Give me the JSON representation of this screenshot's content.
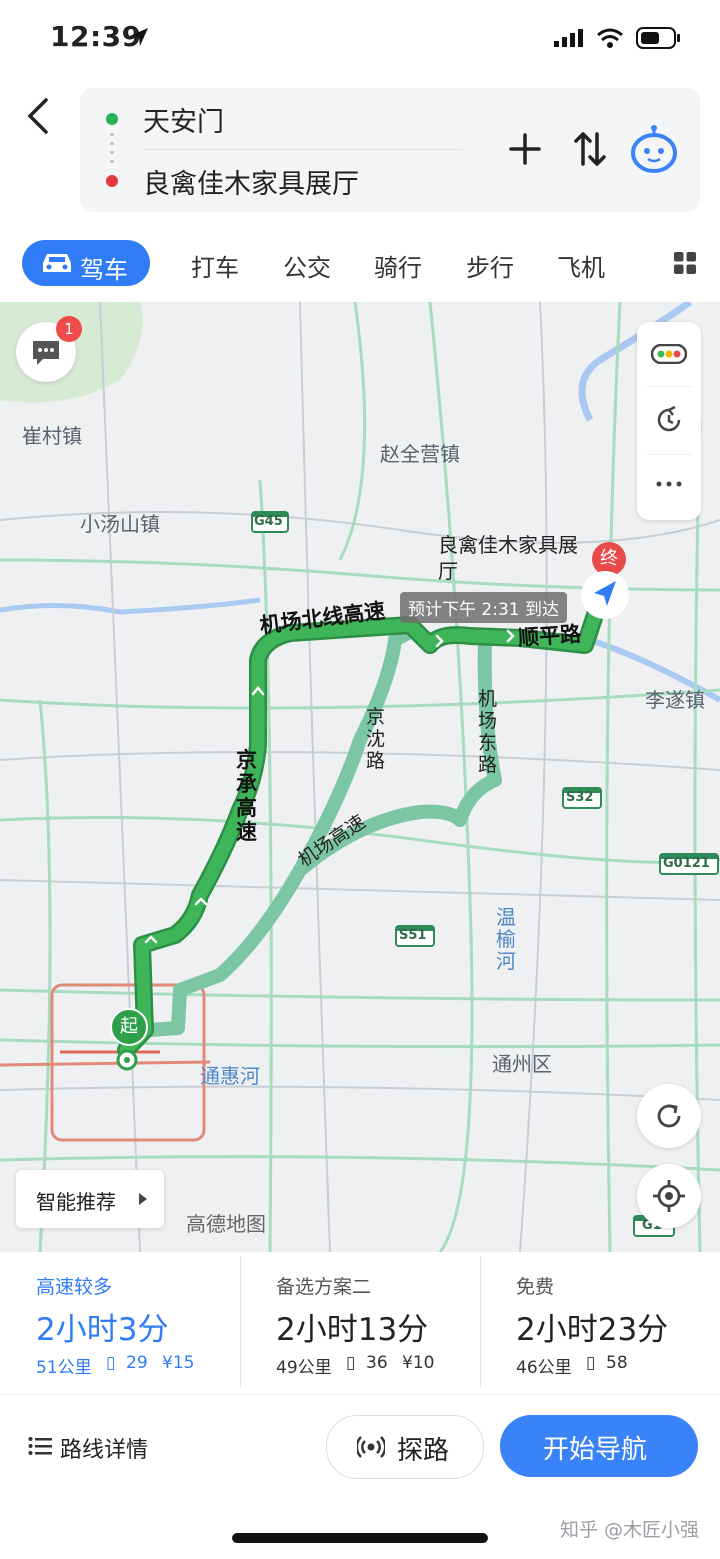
{
  "status_bar": {
    "time": "12:39"
  },
  "header": {
    "origin": "天安门",
    "destination": "良禽佳木家具展厅"
  },
  "tabs": [
    {
      "label": "驾车",
      "selected": true
    },
    {
      "label": "打车"
    },
    {
      "label": "公交"
    },
    {
      "label": "骑行"
    },
    {
      "label": "步行"
    },
    {
      "label": "飞机"
    }
  ],
  "map": {
    "message_badge": "1",
    "labels": {
      "cuicun": "崔村镇",
      "zhaoquanying": "赵全营镇",
      "xiaotangshan": "小汤山镇",
      "lisui": "李遂镇",
      "tongzhou": "通州区",
      "tonghuihe": "通惠河",
      "wenyuhe": "温榆河",
      "watermark": "高德地图"
    },
    "highway_shields": [
      "G45",
      "S32",
      "G0121",
      "S51",
      "G1"
    ],
    "route_labels": {
      "airport_north": "机场北线高速",
      "shunping": "顺平路",
      "jingcheng": "京承高速",
      "jingshen": "京沈路",
      "airport_east": "机场东路",
      "airport_expressway": "机场高速"
    },
    "destination_label": "良禽佳木家具展厅",
    "destination_pin": "终",
    "start_pin": "起",
    "eta": "预计下午 2:31 到达",
    "smart_recommend": "智能推荐"
  },
  "plans": [
    {
      "tag": "高速较多",
      "duration": "2小时3分",
      "distance": "51公里",
      "lights": "29",
      "toll": "¥15",
      "selected": true
    },
    {
      "tag": "备选方案二",
      "duration": "2小时13分",
      "distance": "49公里",
      "lights": "36",
      "toll": "¥10"
    },
    {
      "tag": "免费",
      "duration": "2小时23分",
      "distance": "46公里",
      "lights": "58",
      "toll": ""
    }
  ],
  "toolbar": {
    "details_label": "路线详情",
    "probe_label": "探路",
    "start_label": "开始导航"
  },
  "watermark": "知乎 @木匠小强",
  "colors": {
    "accent": "#2f7cf6",
    "route_main": "#2ea04a",
    "route_alt": "#7cc6a4",
    "start_button": "#3a82f7"
  }
}
